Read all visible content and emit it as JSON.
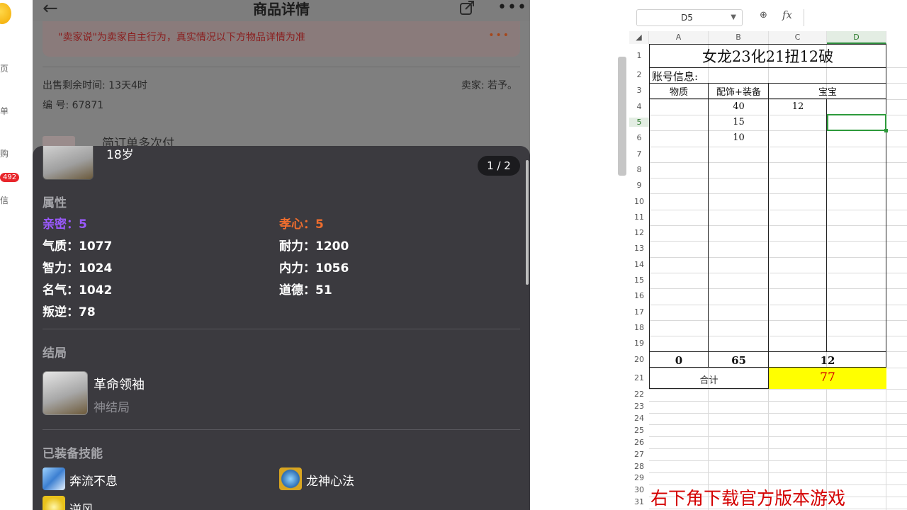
{
  "left_strip": {
    "labels": [
      "页",
      "单",
      "购",
      "信"
    ],
    "badge": "492"
  },
  "app": {
    "header": {
      "title": "商品详情",
      "back_icon": "←",
      "more_icon": "•••"
    },
    "notice": {
      "text": "\"卖家说\"为卖家自主行为，真实情况以下方物品详情为准",
      "dots": "•••"
    },
    "remaining_time": "出售剩余时间: 13天4时",
    "seller": "卖家: 若予。",
    "serial": "编 号: 67871",
    "peek_text": "简订单多次付",
    "card": {
      "age": "18岁",
      "pager": "1 / 2",
      "attributes_title": "属性",
      "attributes": [
        {
          "label": "亲密：",
          "value": "5",
          "color": "#9b59ff"
        },
        {
          "label": "孝心：",
          "value": "5",
          "color": "#ee6d2e"
        },
        {
          "label": "气质：",
          "value": "1077"
        },
        {
          "label": "耐力：",
          "value": "1200"
        },
        {
          "label": "智力：",
          "value": "1024"
        },
        {
          "label": "内力：",
          "value": "1056"
        },
        {
          "label": "名气：",
          "value": "1042"
        },
        {
          "label": "道德：",
          "value": "51"
        },
        {
          "label": "叛逆：",
          "value": "78"
        }
      ],
      "ending_title": "结局",
      "ending_name": "革命领袖",
      "ending_sub": "神结局",
      "skills_title": "已装备技能",
      "skills": [
        {
          "name": "奔流不息"
        },
        {
          "name": "龙神心法"
        },
        {
          "name": "逆风"
        }
      ]
    }
  },
  "sheet": {
    "name_box": "D5",
    "columns": [
      "A",
      "B",
      "C",
      "D"
    ],
    "rows": [
      "1",
      "2",
      "3",
      "4",
      "5",
      "6",
      "7",
      "8",
      "9",
      "10",
      "11",
      "12",
      "13",
      "14",
      "15",
      "16",
      "17",
      "18",
      "19",
      "20",
      "21",
      "22",
      "23",
      "24",
      "25",
      "26",
      "27",
      "28",
      "29",
      "30",
      "31"
    ],
    "title": "女龙23化21扭12破",
    "account_label": "账号信息:",
    "headers": {
      "a": "物质",
      "b": "配饰+装备",
      "cd": "宝宝"
    },
    "b4": "40",
    "c4": "12",
    "b5": "15",
    "b6": "10",
    "a20": "0",
    "b20": "65",
    "cd20": "12",
    "sum_label": "合计",
    "sum_value": "77",
    "ad_text": "右下角下载官方版本游戏",
    "accent": "#ffff00",
    "sum_color": "#d40000"
  }
}
